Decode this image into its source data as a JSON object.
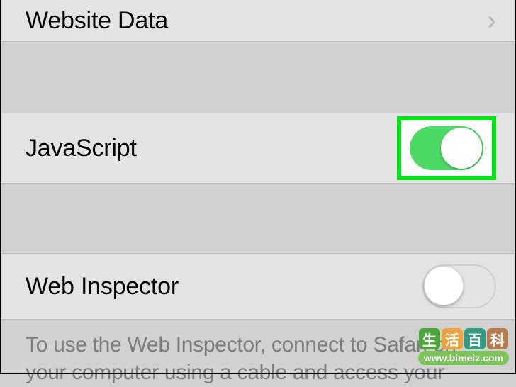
{
  "rows": {
    "website_data": {
      "label": "Website Data"
    },
    "javascript": {
      "label": "JavaScript",
      "toggle_on": true
    },
    "web_inspector": {
      "label": "Web Inspector",
      "toggle_on": false
    }
  },
  "footer": "To use the Web Inspector, connect to Safari on your computer using a cable and access your",
  "watermark": {
    "chars": [
      "生",
      "活",
      "百",
      "科"
    ],
    "url": "www.bimeiz.com"
  }
}
